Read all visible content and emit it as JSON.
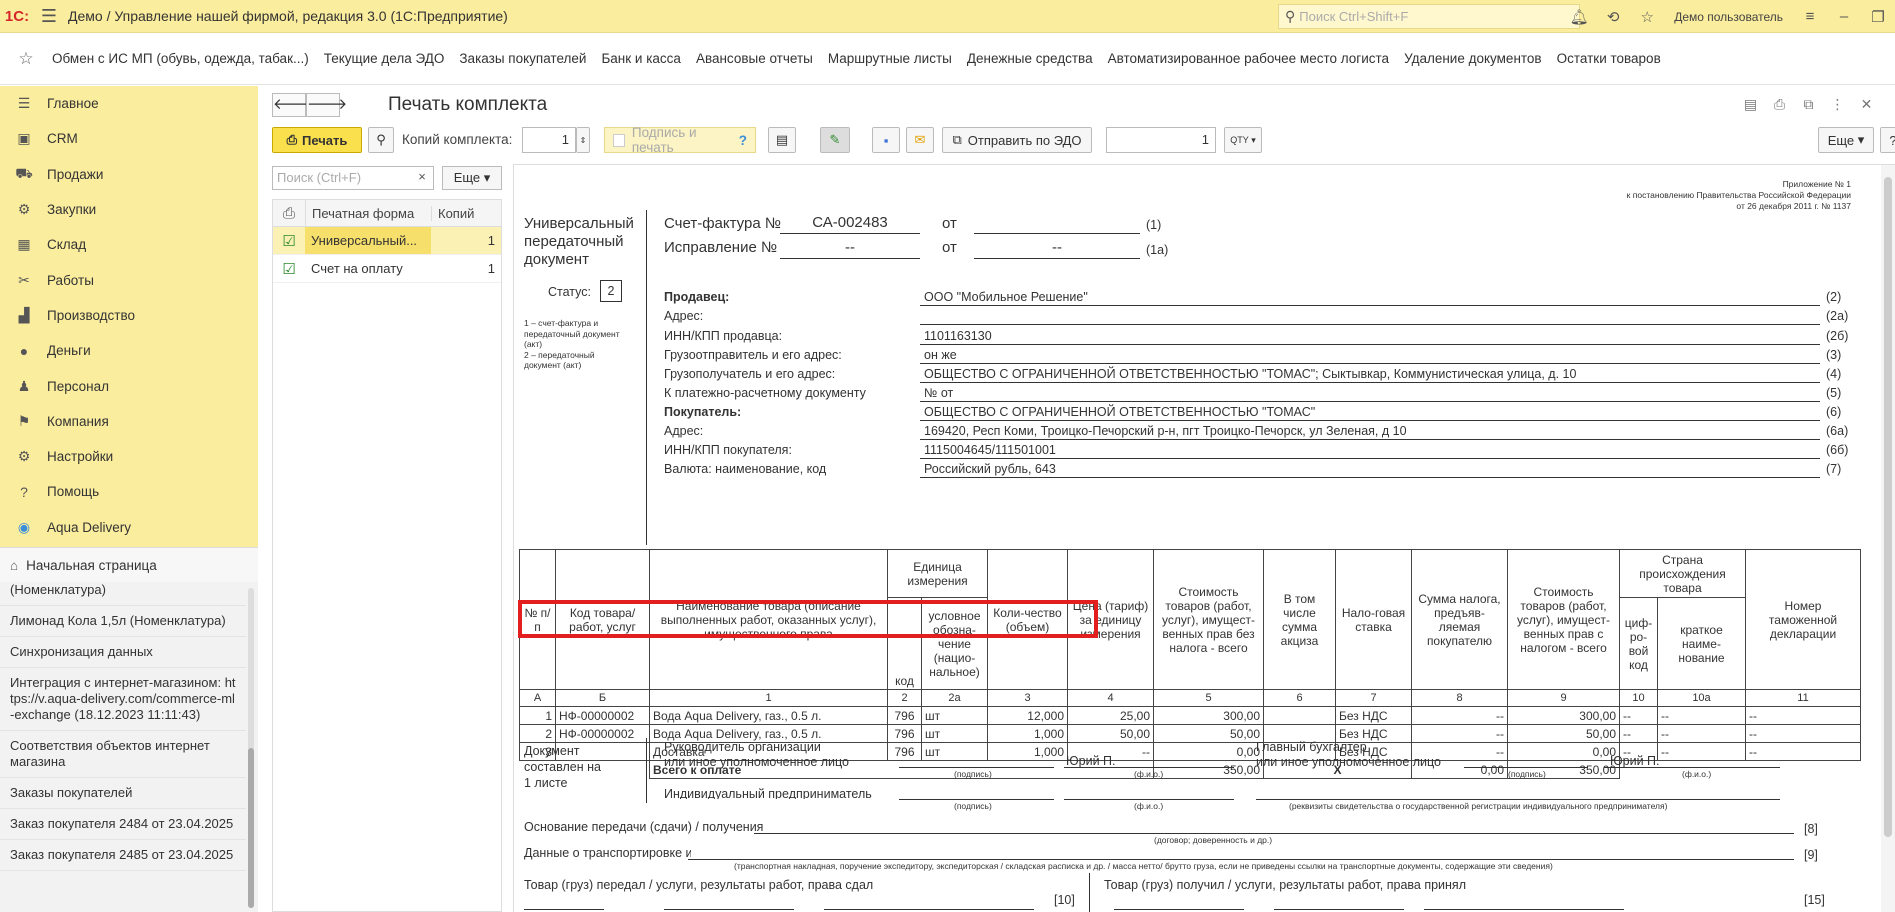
{
  "titlebar": {
    "logo": "1С:",
    "title": "Демо / Управление нашей фирмой, редакция 3.0  (1С:Предприятие)",
    "search_placeholder": "Поиск Ctrl+Shift+F",
    "user": "Демо пользователь"
  },
  "favorites": [
    "Обмен с ИС МП (обувь, одежда, табак...)",
    "Текущие дела ЭДО",
    "Заказы покупателей",
    "Банк и касса",
    "Авансовые отчеты",
    "Маршрутные листы",
    "Денежные средства",
    "Автоматизированное рабочее место логиста",
    "Удаление документов",
    "Остатки товаров"
  ],
  "sidebar": {
    "items": [
      {
        "label": "Главное",
        "icon": "menu-icon"
      },
      {
        "label": "CRM",
        "icon": "crm-icon"
      },
      {
        "label": "Продажи",
        "icon": "cart-icon"
      },
      {
        "label": "Закупки",
        "icon": "purchase-icon"
      },
      {
        "label": "Склад",
        "icon": "warehouse-icon"
      },
      {
        "label": "Работы",
        "icon": "tools-icon"
      },
      {
        "label": "Производство",
        "icon": "factory-icon"
      },
      {
        "label": "Деньги",
        "icon": "money-icon"
      },
      {
        "label": "Персонал",
        "icon": "person-icon"
      },
      {
        "label": "Компания",
        "icon": "flag-icon"
      },
      {
        "label": "Настройки",
        "icon": "gear-icon"
      },
      {
        "label": "Помощь",
        "icon": "help-icon"
      },
      {
        "label": "Aqua Delivery",
        "icon": "location-icon"
      }
    ]
  },
  "history": {
    "home": "Начальная страница",
    "items": [
      "(Номенклатура)",
      "Лимонад Кола 1,5л (Номенклатура)",
      "Синхронизация данных",
      "Интеграция с интернет-магазином: https://v.aqua-delivery.com/commerce-ml-exchange (18.12.2023 11:11:43)",
      "Соответствия объектов интернет магазина",
      "Заказы покупателей",
      "Заказ покупателя 2484 от 23.04.2025",
      "Заказ покупателя 2485 от 23.04.2025"
    ]
  },
  "main": {
    "title": "Печать комплекта",
    "toolbar": {
      "print": "Печать",
      "copies_label": "Копий комплекта:",
      "copies_value": "1",
      "sign_print": "Подпись и печать",
      "send_edo": "Отправить по ЭДО",
      "qty_value": "1",
      "qty_btn": "QTY",
      "more": "Еще",
      "help": "?"
    },
    "forms": {
      "search_placeholder": "Поиск (Ctrl+F)",
      "more": "Еще",
      "col_name": "Печатная форма",
      "col_count": "Копий",
      "rows": [
        {
          "name": "Универсальный...",
          "count": "1"
        },
        {
          "name": "Счет на оплату",
          "count": "1"
        }
      ]
    }
  },
  "doc": {
    "appendix": [
      "Приложение № 1",
      "к постановлению Правительства Российской Федерации",
      "от 26 декабря 2011 г. № 1137"
    ],
    "upd_title": [
      "Универсальный",
      "передаточный",
      "документ"
    ],
    "status_label": "Статус:",
    "status_value": "2",
    "status_note": [
      "1 – счет-фактура и",
      "передаточный документ",
      "(акт)",
      "2 – передаточный",
      "документ (акт)"
    ],
    "invoice_label": "Счет-фактура №",
    "invoice_no": "СА-002483",
    "from": "от",
    "code1": "(1)",
    "correction_label": "Исправление №",
    "correction_no": "--",
    "correction_date": "--",
    "code1a": "(1а)",
    "fields": [
      {
        "label": "Продавец:",
        "value": "ООО \"Мобильное Решение\"",
        "code": "(2)",
        "bold": true
      },
      {
        "label": "Адрес:",
        "value": "",
        "code": "(2а)",
        "bold": false
      },
      {
        "label": "ИНН/КПП продавца:",
        "value": "1101163130",
        "code": "(2б)",
        "bold": false
      },
      {
        "label": "Грузоотправитель и его адрес:",
        "value": "он же",
        "code": "(3)",
        "bold": false
      },
      {
        "label": "Грузополучатель и его адрес:",
        "value": "ОБЩЕСТВО С ОГРАНИЧЕННОЙ ОТВЕТСТВЕННОСТЬЮ \"ТОМАС\"; Сыктывкар, Коммунистическая улица, д. 10",
        "code": "(4)",
        "bold": false
      },
      {
        "label": "К платежно-расчетному документу",
        "value": "№   от",
        "code": "(5)",
        "bold": false
      },
      {
        "label": "Покупатель:",
        "value": "ОБЩЕСТВО С ОГРАНИЧЕННОЙ ОТВЕТСТВЕННОСТЬЮ \"ТОМАС\"",
        "code": "(6)",
        "bold": true
      },
      {
        "label": "Адрес:",
        "value": "169420, Респ Коми, Троицко-Печорский р-н, пгт Троицко-Печорск, ул Зеленая, д 10",
        "code": "(6а)",
        "bold": false
      },
      {
        "label": "ИНН/КПП покупателя:",
        "value": "1115004645/111501001",
        "code": "(6б)",
        "bold": false
      },
      {
        "label": "Валюта: наименование, код",
        "value": "Российский рубль, 643",
        "code": "(7)",
        "bold": false
      }
    ],
    "table": {
      "h_no": "№ п/п",
      "h_code": "Код товара/ работ, услуг",
      "h_name": "Наименование товара (описание выполненных работ, оказанных услуг), имущественного права",
      "h_unit": "Единица измерения",
      "h_unit_code": "код",
      "h_unit_name": "условное обозна-чение (нацио-нальное)",
      "h_qty": "Коли-чество (объем)",
      "h_price": "Цена (тариф) за единицу измерения",
      "h_sum_novat": "Стоимость товаров (работ, услуг), имущест-венных прав без налога - всего",
      "h_excise": "В том числе сумма акциза",
      "h_rate": "Нало-говая ставка",
      "h_tax": "Сумма налога, предъяв-ляемая покупателю",
      "h_sum_vat": "Стоимость товаров (работ, услуг), имущест-венных прав с налогом - всего",
      "h_country": "Страна происхождения товара",
      "h_country_code": "циф-ро-вой код",
      "h_country_name": "краткое наиме-нование",
      "h_customs": "Номер таможенной декларации",
      "nums": [
        "А",
        "Б",
        "1",
        "2",
        "2а",
        "3",
        "4",
        "5",
        "6",
        "7",
        "8",
        "9",
        "10",
        "10а",
        "11"
      ],
      "rows": [
        {
          "no": "1",
          "code": "НФ-00000002",
          "name": "Вода Aqua Delivery, газ., 0.5 л.",
          "ucode": "796",
          "uname": "шт",
          "qty": "12,000",
          "price": "25,00",
          "sum": "300,00",
          "excise": "",
          "rate": "Без НДС",
          "tax": "--",
          "total": "300,00",
          "cc": "--",
          "cn": "--",
          "decl": "--"
        },
        {
          "no": "2",
          "code": "НФ-00000002",
          "name": "Вода Aqua Delivery, газ., 0.5 л.",
          "ucode": "796",
          "uname": "шт",
          "qty": "1,000",
          "price": "50,00",
          "sum": "50,00",
          "excise": "",
          "rate": "Без НДС",
          "tax": "--",
          "total": "50,00",
          "cc": "--",
          "cn": "--",
          "decl": "--"
        },
        {
          "no": "3",
          "code": "",
          "name": "Доставка",
          "ucode": "796",
          "uname": "шт",
          "qty": "1,000",
          "price": "--",
          "sum": "0,00",
          "excise": "",
          "rate": "Без НДС",
          "tax": "--",
          "total": "0,00",
          "cc": "--",
          "cn": "--",
          "decl": "--"
        }
      ],
      "total_label": "Всего к оплате",
      "total_sum": "350,00",
      "total_x": "X",
      "total_tax": "0,00",
      "total_vat": "350,00"
    },
    "doc_sheets": [
      "Документ",
      "составлен на",
      "1 листе"
    ],
    "head_label": [
      "Руководитель организации",
      "или иное уполномоченное лицо"
    ],
    "head_name": "Юрий П.",
    "acc_label": [
      "Главный бухгалтер",
      "или иное уполномоченное лицо"
    ],
    "acc_name": "Юрий П.",
    "sign_cap": "(подпись)",
    "fio_cap": "(ф.и.о.)",
    "ip_label": "Индивидуальный предприниматель",
    "ip_cap": "(реквизиты свидетельства о государственной  регистрации индивидуального предпринимателя)",
    "basis_label": "Основание передачи (сдачи) / получения (приемки)",
    "basis_cap": "(договор; доверенность и др.)",
    "basis_code": "[8]",
    "transport_label": "Данные о транспортировке и грузе",
    "transport_cap": "(транспортная накладная, поручение экспедитору, экспедиторская / складская расписка и др. / масса нетто/ брутто груза, если не приведены ссылки на транспортные документы, содержащие эти сведения)",
    "transport_code": "[9]",
    "passed_label": "Товар (груз) передал / услуги, результаты работ, права сдал",
    "passed_code": "[10]",
    "received_label": "Товар (груз) получил / услуги, результаты работ, права принял",
    "received_code": "[15]"
  }
}
